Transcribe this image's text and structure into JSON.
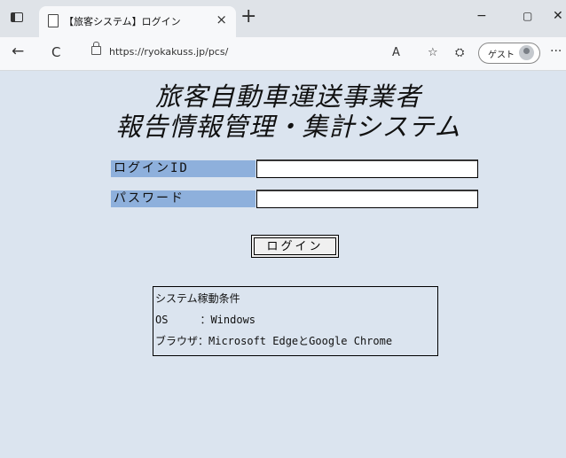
{
  "browser": {
    "tab_title": "【旅客システム】ログイン",
    "tab_close": "×",
    "new_tab": "+",
    "url": "https://ryokakuss.jp/pcs/",
    "guest_label": "ゲスト",
    "minimize": "−",
    "maximize": "▢",
    "close": "✕",
    "more": "···",
    "back": "←",
    "reload": "C",
    "read_aloud": "A",
    "favorites": "☆",
    "extensions": "⛭"
  },
  "page": {
    "title_line1": "旅客自動車運送事業者",
    "title_line2": "報告情報管理・集計システム",
    "login_id_label": "ログインID",
    "password_label": "パスワード",
    "login_id_value": "",
    "password_value": "",
    "login_button": "ログイン",
    "requirements": {
      "heading": "システム稼動条件",
      "os_line": "OS　　　：Windows",
      "browser_line": "ブラウザ：Microsoft EdgeとGoogle Chrome"
    }
  }
}
